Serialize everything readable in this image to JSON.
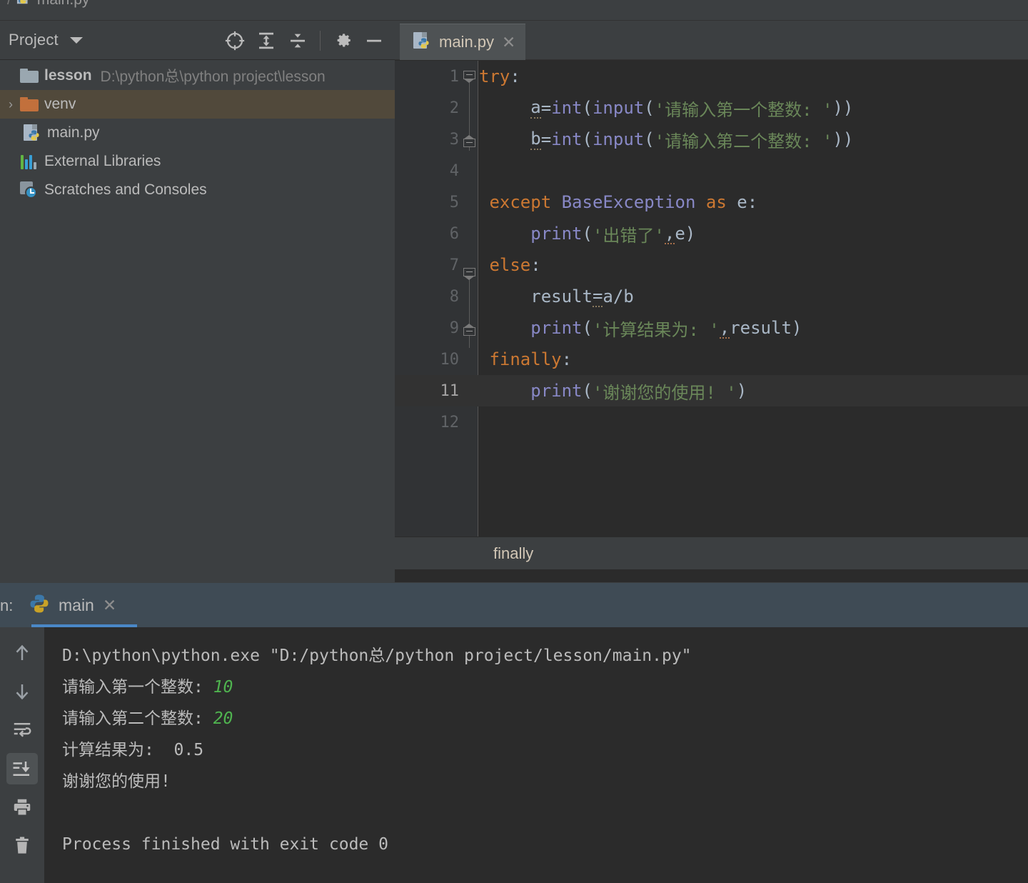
{
  "breadcrumb_top": {
    "separator": "/",
    "file": "main.py",
    "icon": "python-file-icon"
  },
  "project": {
    "title": "Project",
    "toolbar": [
      {
        "name": "select-opened-file-icon",
        "label": "Select Opened File"
      },
      {
        "name": "expand-all-icon",
        "label": "Expand All"
      },
      {
        "name": "collapse-all-icon",
        "label": "Collapse All"
      },
      {
        "name": "settings-gear-icon",
        "label": "Settings"
      },
      {
        "name": "hide-icon",
        "label": "Hide"
      }
    ],
    "tree": [
      {
        "label": "lesson",
        "path": "D:\\python总\\python project\\lesson",
        "icon": "folder-grey-icon",
        "bold": true,
        "selected": false,
        "twisty": ""
      },
      {
        "label": "venv",
        "path": "",
        "icon": "folder-orange-icon",
        "bold": false,
        "selected": true,
        "twisty": "›"
      },
      {
        "label": "main.py",
        "path": "",
        "icon": "python-file-icon",
        "bold": false,
        "selected": false,
        "twisty": ""
      },
      {
        "label": "External Libraries",
        "path": "",
        "icon": "library-bars-icon",
        "bold": false,
        "selected": false,
        "twisty": ""
      },
      {
        "label": "Scratches and Consoles",
        "path": "",
        "icon": "scratches-clock-icon",
        "bold": false,
        "selected": false,
        "twisty": ""
      }
    ]
  },
  "editor": {
    "tab": {
      "label": "main.py",
      "icon": "python-file-icon",
      "close": "✕"
    },
    "current_line": 11,
    "breadcrumb": "finally",
    "lines": [
      {
        "n": "1",
        "indent": 0
      },
      {
        "n": "2",
        "indent": 0
      },
      {
        "n": "3",
        "indent": 0
      },
      {
        "n": "4",
        "indent": 0
      },
      {
        "n": "5",
        "indent": 0
      },
      {
        "n": "6",
        "indent": 0
      },
      {
        "n": "7",
        "indent": 0
      },
      {
        "n": "8",
        "indent": 0
      },
      {
        "n": "9",
        "indent": 0
      },
      {
        "n": "10",
        "indent": 0
      },
      {
        "n": "11",
        "indent": 0
      },
      {
        "n": "12",
        "indent": 0
      }
    ],
    "source": [
      "try:",
      "    a=int(input('请输入第一个整数: '))",
      "    b=int(input('请输入第二个整数: '))",
      "",
      "except BaseException as e:",
      "    print('出错了',e)",
      "else:",
      "    result=a/b",
      "    print('计算结果为: ',result)",
      "finally:",
      "    print('谢谢您的使用! ')",
      ""
    ],
    "tokens": {
      "l1": [
        {
          "t": "try",
          "c": "kw"
        },
        {
          "t": ":",
          "c": "pln"
        }
      ],
      "l2": [
        {
          "t": "     a",
          "c": "pln"
        },
        {
          "t": "=",
          "c": "pln"
        },
        {
          "t": "int",
          "c": "fn"
        },
        {
          "t": "(",
          "c": "pln"
        },
        {
          "t": "input",
          "c": "fn"
        },
        {
          "t": "(",
          "c": "pln"
        },
        {
          "t": "'请输入第一个整数: '",
          "c": "str"
        },
        {
          "t": "))",
          "c": "pln"
        }
      ],
      "l3": [
        {
          "t": "     b",
          "c": "pln"
        },
        {
          "t": "=",
          "c": "pln"
        },
        {
          "t": "int",
          "c": "fn"
        },
        {
          "t": "(",
          "c": "pln"
        },
        {
          "t": "input",
          "c": "fn"
        },
        {
          "t": "(",
          "c": "pln"
        },
        {
          "t": "'请输入第二个整数: '",
          "c": "str"
        },
        {
          "t": "))",
          "c": "pln"
        }
      ],
      "l4": [],
      "l5": [
        {
          "t": "except",
          "c": "kw"
        },
        {
          "t": " ",
          "c": "pln"
        },
        {
          "t": "BaseException",
          "c": "fn"
        },
        {
          "t": " ",
          "c": "pln"
        },
        {
          "t": "as",
          "c": "kw"
        },
        {
          "t": " e:",
          "c": "pln"
        }
      ],
      "l6": [
        {
          "t": "    ",
          "c": "pln"
        },
        {
          "t": "print",
          "c": "fn"
        },
        {
          "t": "(",
          "c": "pln"
        },
        {
          "t": "'出错了'",
          "c": "str"
        },
        {
          "t": ",",
          "c": "pln"
        },
        {
          "t": "e)",
          "c": "pln"
        }
      ],
      "l7": [
        {
          "t": "else",
          "c": "kw"
        },
        {
          "t": ":",
          "c": "pln"
        }
      ],
      "l8": [
        {
          "t": "    result=a/b",
          "c": "pln"
        }
      ],
      "l9": [
        {
          "t": "    ",
          "c": "pln"
        },
        {
          "t": "print",
          "c": "fn"
        },
        {
          "t": "(",
          "c": "pln"
        },
        {
          "t": "'计算结果为: '",
          "c": "str"
        },
        {
          "t": ",",
          "c": "pln"
        },
        {
          "t": "result)",
          "c": "pln"
        }
      ],
      "l10": [
        {
          "t": "finally",
          "c": "kw"
        },
        {
          "t": ":",
          "c": "pln"
        }
      ],
      "l11": [
        {
          "t": "    ",
          "c": "pln"
        },
        {
          "t": "print",
          "c": "fn"
        },
        {
          "t": "(",
          "c": "pln"
        },
        {
          "t": "'谢谢您的使用! '",
          "c": "str"
        },
        {
          "t": ")",
          "c": "pln"
        }
      ],
      "l12": []
    }
  },
  "run": {
    "side_label": "n:",
    "tab": {
      "label": "main",
      "icon": "python-icon",
      "close": "✕"
    },
    "toolbar": [
      {
        "name": "up-arrow-icon",
        "label": "Up the Stack Trace",
        "active": false
      },
      {
        "name": "down-arrow-icon",
        "label": "Down the Stack Trace",
        "active": false
      },
      {
        "name": "soft-wrap-icon",
        "label": "Use Soft Wraps",
        "active": false
      },
      {
        "name": "scroll-to-end-icon",
        "label": "Scroll to End",
        "active": true
      },
      {
        "name": "print-icon",
        "label": "Print",
        "active": false
      },
      {
        "name": "trash-icon",
        "label": "Clear All",
        "active": false
      }
    ],
    "console_lines": [
      {
        "text": "D:\\python\\python.exe \"D:/python总/python project/lesson/main.py\"",
        "value": "",
        "style": "plain"
      },
      {
        "text": "请输入第一个整数: ",
        "value": "10",
        "style": "input"
      },
      {
        "text": "请输入第二个整数: ",
        "value": "20",
        "style": "input"
      },
      {
        "text": "计算结果为:  0.5",
        "value": "",
        "style": "plain"
      },
      {
        "text": "谢谢您的使用!",
        "value": "",
        "style": "plain"
      },
      {
        "text": "",
        "value": "",
        "style": "blank"
      },
      {
        "text": "Process finished with exit code 0",
        "value": "",
        "style": "plain"
      }
    ]
  },
  "colors": {
    "panel_bg": "#3C3F41",
    "editor_bg": "#2B2B2B",
    "gutter_bg": "#313335",
    "keyword": "#CC7832",
    "function": "#8888C6",
    "string": "#6A8759",
    "text": "#A9B7C6",
    "selection": "#51493B",
    "run_header": "#3F4B55",
    "tab_underline": "#4A88C7",
    "console_input": "#4FB34F",
    "folder_orange": "#C2703C"
  }
}
